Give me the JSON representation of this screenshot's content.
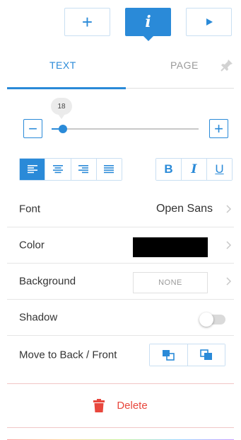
{
  "toolbar": {
    "add_icon": "plus-icon",
    "info_icon": "info-icon",
    "play_icon": "play-icon",
    "accent_color": "#2a8ad8"
  },
  "tabs": [
    {
      "label": "TEXT",
      "active": true
    },
    {
      "label": "PAGE",
      "active": false
    }
  ],
  "font_size": {
    "value": "18",
    "min_label": "−",
    "max_label": "+"
  },
  "alignment": {
    "options": [
      "align-left",
      "align-center",
      "align-right",
      "justify"
    ],
    "selected": "align-left"
  },
  "text_style": {
    "bold": "B",
    "italic": "I",
    "underline": "U"
  },
  "properties": {
    "font_label": "Font",
    "font_value": "Open Sans",
    "color_label": "Color",
    "color_value": "#000000",
    "background_label": "Background",
    "background_value": "NONE",
    "shadow_label": "Shadow",
    "shadow_enabled": false,
    "order_label": "Move to Back / Front"
  },
  "actions": {
    "delete_label": "Delete",
    "delete_color": "#e8473d"
  }
}
